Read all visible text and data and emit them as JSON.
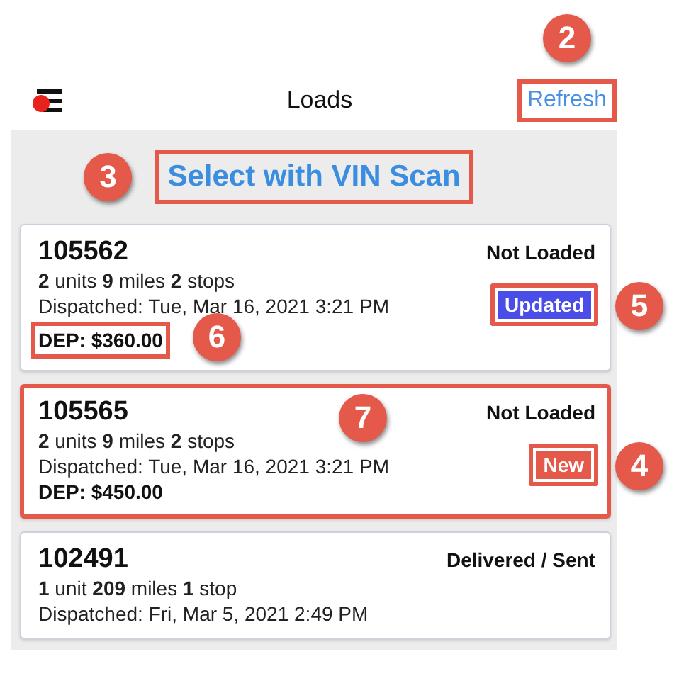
{
  "header": {
    "title": "Loads",
    "refresh": {
      "label": "Refresh",
      "highlighted": true,
      "callout": "2"
    },
    "menu_has_alert": true
  },
  "vin_scan": {
    "label": "Select with VIN Scan",
    "highlighted": true,
    "callout": "3"
  },
  "loads": [
    {
      "number": "105562",
      "status": "Not Loaded",
      "summary": "**2** units  **9** miles **2** stops",
      "dispatched": "Dispatched: Tue, Mar 16, 2021 3:21 PM",
      "deposit": {
        "text": "DEP: $360.00",
        "highlighted": true,
        "callout": "6"
      },
      "badge": {
        "text": "Updated",
        "kind": "updated",
        "highlighted": true,
        "callout": "5"
      },
      "highlighted": false
    },
    {
      "number": "105565",
      "status": "Not Loaded",
      "summary": "**2** units  **9** miles **2** stops",
      "dispatched": "Dispatched: Tue, Mar 16, 2021 3:21 PM",
      "deposit": {
        "text": "DEP: $450.00"
      },
      "badge": {
        "text": "New",
        "kind": "new",
        "highlighted": true,
        "callout": "4"
      },
      "highlighted": true,
      "callout": "7"
    },
    {
      "number": "102491",
      "status": "Delivered / Sent",
      "summary": "**1** unit  **209** miles **1** stop",
      "dispatched": "Dispatched: Fri, Mar 5, 2021 2:49 PM",
      "highlighted": false
    }
  ]
}
